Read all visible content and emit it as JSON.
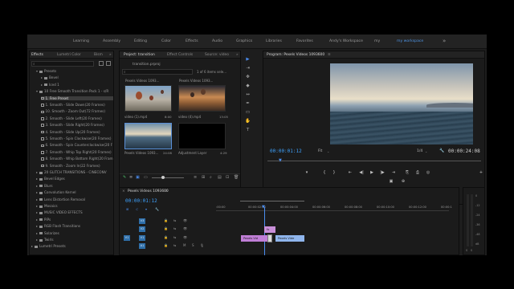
{
  "workspaces": [
    "Learning",
    "Assembly",
    "Editing",
    "Color",
    "Effects",
    "Audio",
    "Graphics",
    "Libraries",
    "Favorites",
    "Andy's Workspace",
    "my",
    "my workspace"
  ],
  "workspace_more": "»",
  "effects_panel": {
    "tabs": [
      "Effects",
      "Lumetri Color",
      "Bism"
    ],
    "tab_more": "»",
    "search_placeholder": "",
    "items": [
      {
        "label": "Presets",
        "indent": 1,
        "kind": "folder",
        "open": true
      },
      {
        "label": "Bevel",
        "indent": 2,
        "kind": "folder"
      },
      {
        "label": "Iced 1",
        "indent": 2,
        "kind": "folder"
      },
      {
        "label": "10 Free Smooth Transition Pack 1 - s/R",
        "indent": 1,
        "kind": "folder",
        "open": true
      },
      {
        "label": "1. Free Preset",
        "indent": 2,
        "kind": "effect",
        "selected": true
      },
      {
        "label": "1. Smooth - Slide Down(20 Frames)",
        "indent": 2,
        "kind": "effect"
      },
      {
        "label": "10. Smooth - Zoom Out(72 Frames)",
        "indent": 2,
        "kind": "effect"
      },
      {
        "label": "2. Smooth - Slide Left(20 Frames)",
        "indent": 2,
        "kind": "effect"
      },
      {
        "label": "3. Smooth - Slide Right(20 Frames)",
        "indent": 2,
        "kind": "effect"
      },
      {
        "label": "4. Smooth - Slide Up(20 Frames)",
        "indent": 2,
        "kind": "effect"
      },
      {
        "label": "5. Smooth - Spin Clockwise(20 Frames)",
        "indent": 2,
        "kind": "effect"
      },
      {
        "label": "6. Smooth - Spin Counterclockwise(20 F",
        "indent": 2,
        "kind": "effect"
      },
      {
        "label": "7. Smooth - Whip Top Right(20 Frames)",
        "indent": 2,
        "kind": "effect"
      },
      {
        "label": "8. Smooth - Whip Bottom Right(20 Fram",
        "indent": 2,
        "kind": "effect"
      },
      {
        "label": "9. Smooth - Zoom In(22 Frames)",
        "indent": 2,
        "kind": "effect"
      },
      {
        "label": "20 GLITCH TRANSITIONS - CINECONV",
        "indent": 1,
        "kind": "folder"
      },
      {
        "label": "Bevel Edges",
        "indent": 1,
        "kind": "folder"
      },
      {
        "label": "Blurs",
        "indent": 1,
        "kind": "folder"
      },
      {
        "label": "Convolution Kernel",
        "indent": 1,
        "kind": "folder"
      },
      {
        "label": "Lens Distortion Removal",
        "indent": 1,
        "kind": "folder"
      },
      {
        "label": "Mosaics",
        "indent": 1,
        "kind": "folder"
      },
      {
        "label": "MUSIC VIDEO EFFECTS",
        "indent": 1,
        "kind": "folder"
      },
      {
        "label": "PiPs",
        "indent": 1,
        "kind": "folder"
      },
      {
        "label": "RGB Flash Transitions",
        "indent": 1,
        "kind": "folder"
      },
      {
        "label": "Solarizes",
        "indent": 1,
        "kind": "folder"
      },
      {
        "label": "Twirls",
        "indent": 1,
        "kind": "folder"
      },
      {
        "label": "Lumetri Presets",
        "indent": 0,
        "kind": "folder"
      }
    ]
  },
  "project_panel": {
    "tabs": [
      "Project: transition",
      "Effect Controls",
      "Source: video"
    ],
    "tab_more": "»",
    "file_name": "transition.prproj",
    "item_count": "1 of 6 items sele...",
    "items": [
      {
        "top_label": "Pexels Videos 1093...",
        "label": "video (1).mp4",
        "duration": "8:00",
        "scene": "balloons"
      },
      {
        "top_label": "Pexels Videos 1093...",
        "label": "video (4).mp4",
        "duration": "13:05",
        "scene": "sunset"
      },
      {
        "label": "Pexels Videos 1093...",
        "duration": "24:08",
        "scene": "sea"
      },
      {
        "label": "Adjustment Layer",
        "duration": "4:29",
        "scene": "black"
      }
    ]
  },
  "program_monitor": {
    "title": "Program: Pexels Videos 1093600",
    "title_menu": "≡",
    "timecode": "00:00:01:12",
    "fit": "Fit",
    "resolution": "1/4",
    "duration": "00:00:24:08",
    "wrench": "🔧"
  },
  "timeline": {
    "tab_close": "×",
    "title": "Pexels Videos 1093600",
    "title_menu": "≡",
    "timecode": "00:00:01:12",
    "ruler": [
      ":00:00",
      "00:00:02:00",
      "00:00:04:00",
      "00:00:06:00",
      "00:00:08:00",
      "00:00:10:00",
      "00:00:12:00",
      "00:00:1"
    ],
    "tracks": [
      {
        "name": "V3",
        "lock": "🔒",
        "sync": "⇆",
        "eye": "👁"
      },
      {
        "name": "V2",
        "lock": "🔒",
        "sync": "⇆",
        "eye": "👁"
      },
      {
        "name": "V1",
        "lock": "🔒",
        "sync": "⇆",
        "eye": "👁",
        "source": "V1"
      },
      {
        "name": "A1",
        "lock": "🔒",
        "sync": "⇆",
        "m": "M",
        "s": "S",
        "mic": "🎙"
      }
    ],
    "clips": [
      {
        "track": "V2",
        "label": "fx",
        "color": "#c98fd9"
      },
      {
        "track": "V1",
        "label": "Pexels Vid",
        "color": "#c07ed6"
      },
      {
        "track": "V1",
        "label": "Pexels Vide",
        "color": "#8fb5ec"
      }
    ],
    "clip_fx_badge": "fx"
  },
  "audio_meter": {
    "ticks": [
      "0",
      "-12",
      "-24",
      "-36",
      "-48",
      "dB"
    ],
    "solo": [
      "S",
      "S"
    ]
  },
  "colors": {
    "accent": "#3fa3ff",
    "workspace_active": "#4f95e6",
    "playhead": "#4b8df0",
    "panel_bg": "#1b1b1b"
  }
}
